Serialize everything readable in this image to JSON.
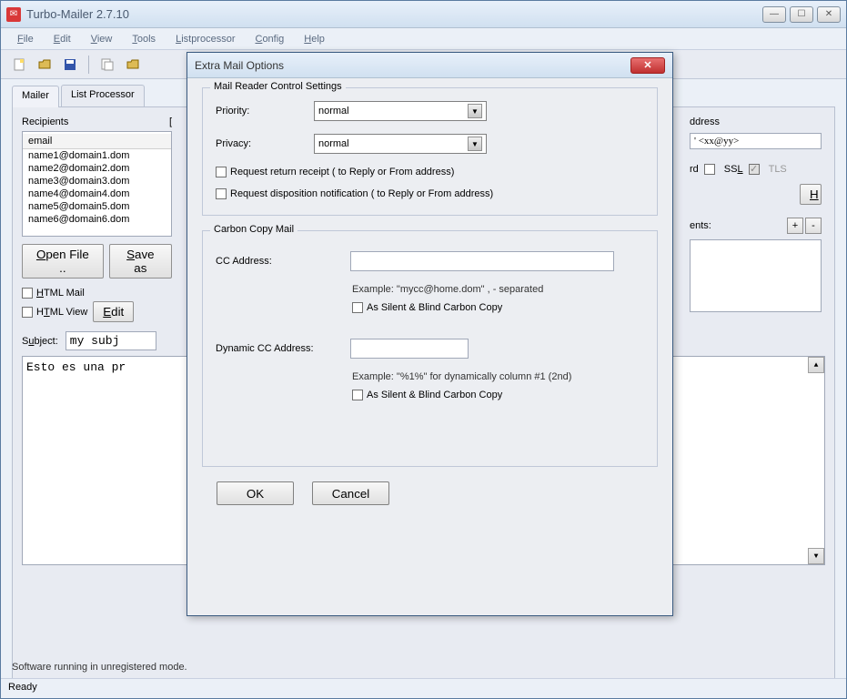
{
  "window": {
    "title": "Turbo-Mailer 2.7.10"
  },
  "menubar": {
    "file": "File",
    "edit": "Edit",
    "view": "View",
    "tools": "Tools",
    "listprocessor": "Listprocessor",
    "config": "Config",
    "help": "Help"
  },
  "tabs": {
    "mailer": "Mailer",
    "listprocessor": "List Processor"
  },
  "main": {
    "recipients_label": "Recipients",
    "recipients_bracket": "[",
    "email_header": "email",
    "emails": [
      "name1@domain1.dom",
      "name2@domain2.dom",
      "name3@domain3.dom",
      "name4@domain4.dom",
      "name5@domain5.dom",
      "name6@domain6.dom"
    ],
    "open_file": "Open File ..",
    "save_as": "Save as",
    "html_mail": "HTML Mail",
    "html_view": "HTML View",
    "edit_btn": "Edit",
    "subject_label": "Subject:",
    "subject_value": "my subj",
    "body_text": "Esto es una pr",
    "footer": "Software running in unregistered mode.",
    "statusbar": "Ready"
  },
  "right": {
    "ddress_label": "ddress",
    "email_hint": "' <xx@yy>",
    "rd_label": "rd",
    "ssl": "SSL",
    "tls": "TLS",
    "h_btn": "H",
    "ents_label": "ents:",
    "plus": "+",
    "minus": "-"
  },
  "dialog": {
    "title": "Extra Mail Options",
    "group1_title": "Mail Reader Control Settings",
    "priority_label": "Priority:",
    "priority_value": "normal",
    "privacy_label": "Privacy:",
    "privacy_value": "normal",
    "return_receipt": "Request return receipt  ( to Reply or From address)",
    "disposition": "Request disposition notification  ( to Reply or From address)",
    "group2_title": "Carbon Copy Mail",
    "cc_label": "CC Address:",
    "cc_example": "Example: \"mycc@home.dom\"    , - separated",
    "cc_silent": "As Silent & Blind Carbon Copy",
    "dyncc_label": "Dynamic CC Address:",
    "dyncc_example": "Example: \"%1%\" for dynamically column #1 (2nd)",
    "dyncc_silent": "As Silent & Blind Carbon Copy",
    "ok": "OK",
    "cancel": "Cancel"
  }
}
